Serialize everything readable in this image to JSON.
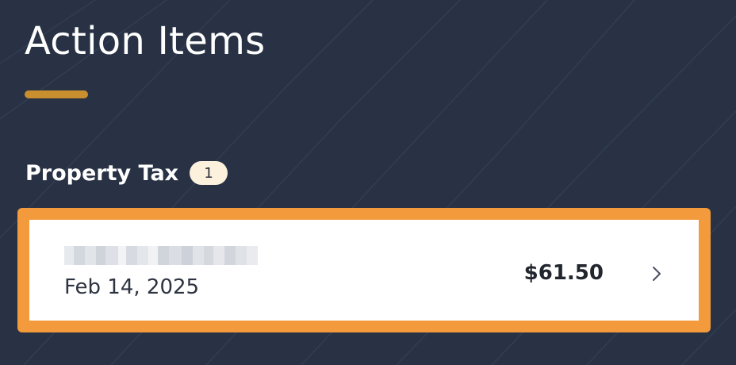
{
  "page": {
    "title": "Action Items"
  },
  "section": {
    "title": "Property Tax",
    "count": "1"
  },
  "items": [
    {
      "date": "Feb 14, 2025",
      "amount": "$61.50"
    }
  ],
  "colors": {
    "background": "#283244",
    "accent_underline": "#c98f2e",
    "card_highlight": "#f39a3c",
    "badge": "#fbf1dc"
  },
  "icons": {
    "item_chevron": "chevron-right-icon"
  }
}
